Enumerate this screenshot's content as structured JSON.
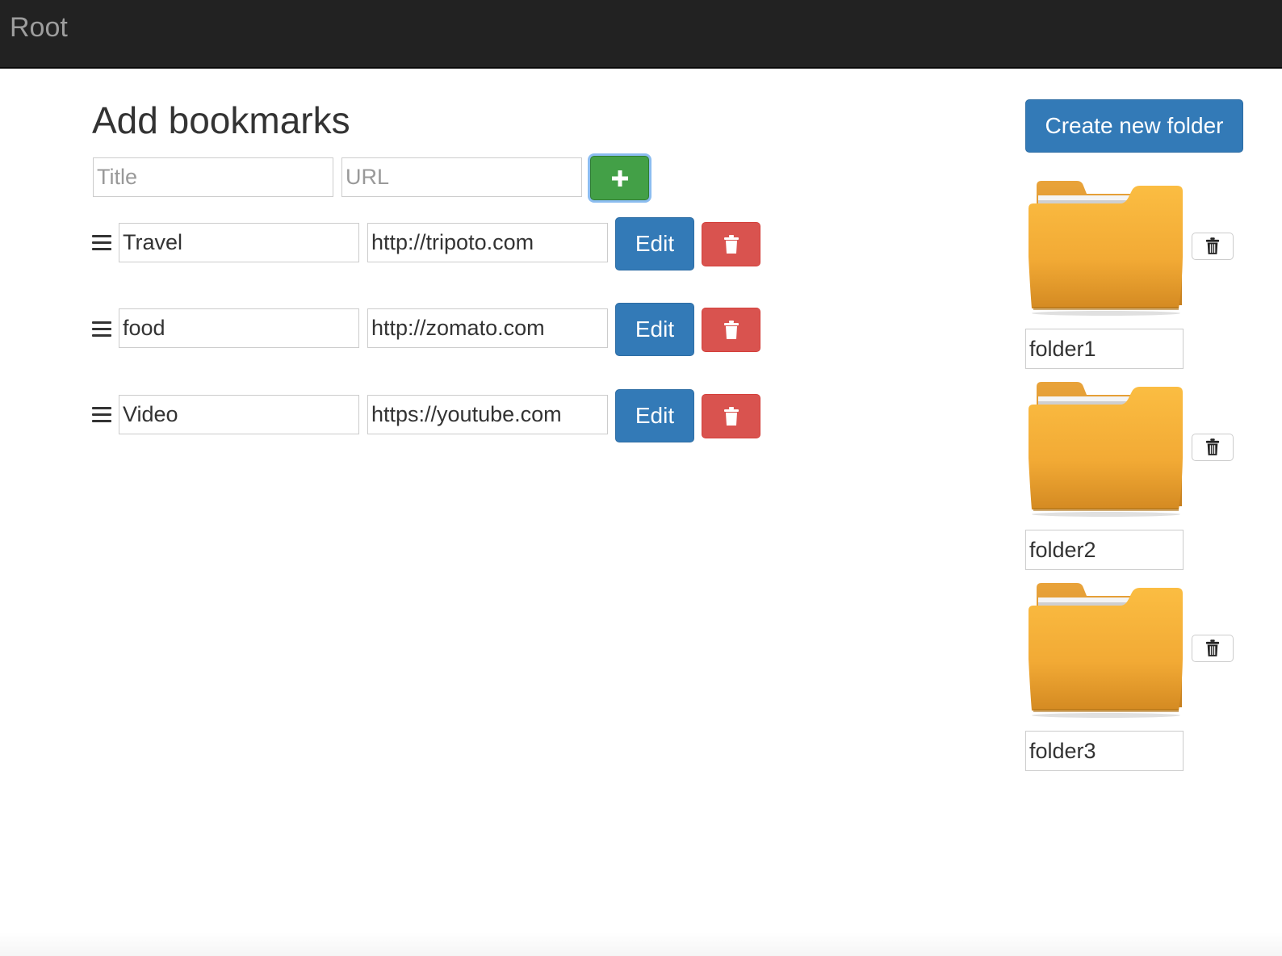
{
  "navbar": {
    "brand": "Root"
  },
  "page": {
    "title": "Add bookmarks"
  },
  "add_form": {
    "title_placeholder": "Title",
    "url_placeholder": "URL",
    "add_icon": "plus-icon"
  },
  "bookmarks": [
    {
      "title": "Travel",
      "url": "http://tripoto.com",
      "edit_label": "Edit",
      "delete_icon": "trash-icon"
    },
    {
      "title": "food",
      "url": "http://zomato.com",
      "edit_label": "Edit",
      "delete_icon": "trash-icon"
    },
    {
      "title": "Video",
      "url": "https://youtube.com",
      "edit_label": "Edit",
      "delete_icon": "trash-icon"
    }
  ],
  "folders_panel": {
    "create_label": "Create new folder",
    "folders": [
      {
        "name": "folder1",
        "icon": "folder-icon",
        "delete_icon": "trash-icon"
      },
      {
        "name": "folder2",
        "icon": "folder-icon",
        "delete_icon": "trash-icon"
      },
      {
        "name": "folder3",
        "icon": "folder-icon",
        "delete_icon": "trash-icon"
      }
    ]
  },
  "colors": {
    "navbar_bg": "#222222",
    "primary": "#337ab7",
    "danger": "#d9534f",
    "success": "#43a047",
    "folder": "#f5b53d"
  }
}
